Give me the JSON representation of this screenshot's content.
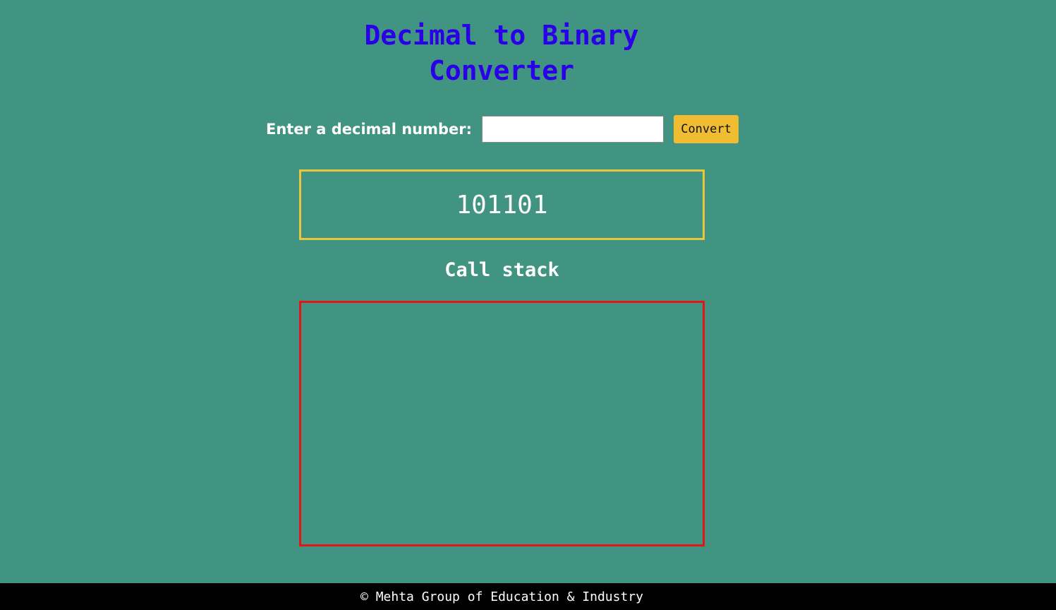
{
  "header": {
    "title_line1": "Decimal to Binary",
    "title_line2": "Converter"
  },
  "form": {
    "label": "Enter a decimal number:",
    "input_value": "",
    "input_placeholder": "",
    "convert_label": "Convert"
  },
  "result": {
    "value": "101101"
  },
  "call_stack": {
    "heading": "Call stack",
    "items": []
  },
  "footer": {
    "text": "© Mehta Group of Education & Industry"
  },
  "colors": {
    "background": "#419481",
    "title": "#2a00e8",
    "button": "#f0bd32",
    "result_border": "#e9c63a",
    "stack_border": "#e01515",
    "footer_bg": "#000000"
  }
}
